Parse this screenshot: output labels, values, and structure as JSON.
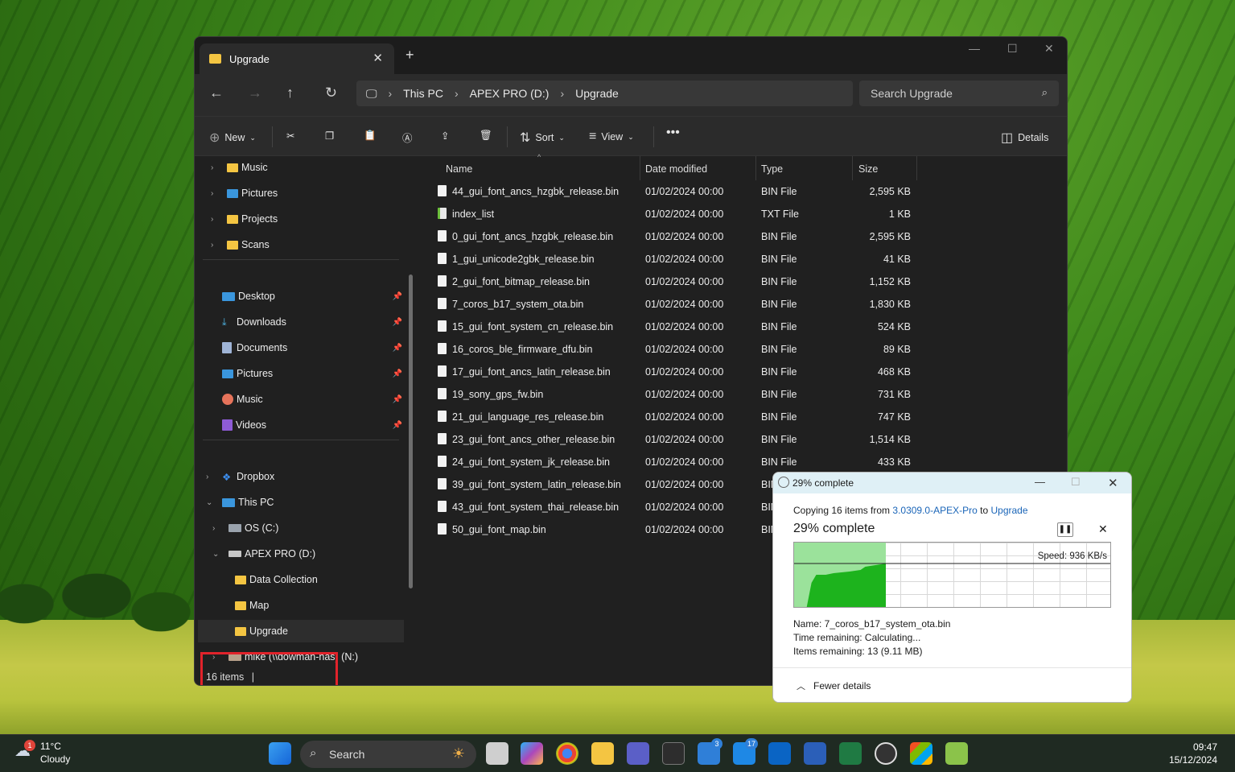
{
  "window": {
    "tab_title": "Upgrade",
    "breadcrumb": [
      "This PC",
      "APEX PRO (D:)",
      "Upgrade"
    ],
    "search_placeholder": "Search Upgrade"
  },
  "commandbar": {
    "new": "New",
    "sort": "Sort",
    "view": "View",
    "details": "Details"
  },
  "nav": {
    "quick": [
      "Music",
      "Pictures",
      "Projects",
      "Scans"
    ],
    "pinned": [
      "Desktop",
      "Downloads",
      "Documents",
      "Pictures",
      "Music",
      "Videos"
    ],
    "dropbox": "Dropbox",
    "thispc": "This PC",
    "osc": "OS (C:)",
    "apex": "APEX PRO (D:)",
    "apex_children": [
      "Data Collection",
      "Map",
      "Upgrade"
    ],
    "nas": "mike (\\\\dowman-nas) (N:)"
  },
  "columns": {
    "name": "Name",
    "date": "Date modified",
    "type": "Type",
    "size": "Size"
  },
  "files": [
    {
      "name": "44_gui_font_ancs_hzgbk_release.bin",
      "date": "01/02/2024 00:00",
      "type": "BIN File",
      "size": "2,595 KB"
    },
    {
      "name": "index_list",
      "date": "01/02/2024 00:00",
      "type": "TXT File",
      "size": "1 KB"
    },
    {
      "name": "0_gui_font_ancs_hzgbk_release.bin",
      "date": "01/02/2024 00:00",
      "type": "BIN File",
      "size": "2,595 KB"
    },
    {
      "name": "1_gui_unicode2gbk_release.bin",
      "date": "01/02/2024 00:00",
      "type": "BIN File",
      "size": "41 KB"
    },
    {
      "name": "2_gui_font_bitmap_release.bin",
      "date": "01/02/2024 00:00",
      "type": "BIN File",
      "size": "1,152 KB"
    },
    {
      "name": "7_coros_b17_system_ota.bin",
      "date": "01/02/2024 00:00",
      "type": "BIN File",
      "size": "1,830 KB"
    },
    {
      "name": "15_gui_font_system_cn_release.bin",
      "date": "01/02/2024 00:00",
      "type": "BIN File",
      "size": "524 KB"
    },
    {
      "name": "16_coros_ble_firmware_dfu.bin",
      "date": "01/02/2024 00:00",
      "type": "BIN File",
      "size": "89 KB"
    },
    {
      "name": "17_gui_font_ancs_latin_release.bin",
      "date": "01/02/2024 00:00",
      "type": "BIN File",
      "size": "468 KB"
    },
    {
      "name": "19_sony_gps_fw.bin",
      "date": "01/02/2024 00:00",
      "type": "BIN File",
      "size": "731 KB"
    },
    {
      "name": "21_gui_language_res_release.bin",
      "date": "01/02/2024 00:00",
      "type": "BIN File",
      "size": "747 KB"
    },
    {
      "name": "23_gui_font_ancs_other_release.bin",
      "date": "01/02/2024 00:00",
      "type": "BIN File",
      "size": "1,514 KB"
    },
    {
      "name": "24_gui_font_system_jk_release.bin",
      "date": "01/02/2024 00:00",
      "type": "BIN File",
      "size": "433 KB"
    },
    {
      "name": "39_gui_font_system_latin_release.bin",
      "date": "01/02/2024 00:00",
      "type": "BIN",
      "size": ""
    },
    {
      "name": "43_gui_font_system_thai_release.bin",
      "date": "01/02/2024 00:00",
      "type": "BIN",
      "size": ""
    },
    {
      "name": "50_gui_font_map.bin",
      "date": "01/02/2024 00:00",
      "type": "BIN",
      "size": ""
    }
  ],
  "status": "16 items",
  "copy_dialog": {
    "title": "29% complete",
    "copy_prefix": "Copying 16 items from",
    "source": "3.0309.0-APEX-Pro",
    "to": "to",
    "dest": "Upgrade",
    "percent_text": "29% complete",
    "progress": 0.29,
    "speed": "Speed: 936 KB/s",
    "name": "Name: 7_coros_b17_system_ota.bin",
    "time_remaining": "Time remaining: Calculating...",
    "items_remaining": "Items remaining: 13 (9.11 MB)",
    "fewer_details": "Fewer details"
  },
  "taskbar": {
    "weather_temp": "11°C",
    "weather_cond": "Cloudy",
    "weather_badge": "1",
    "search": "Search",
    "badge_todo": "3",
    "badge_mail": "17",
    "time": "09:47",
    "date": "15/12/2024"
  }
}
